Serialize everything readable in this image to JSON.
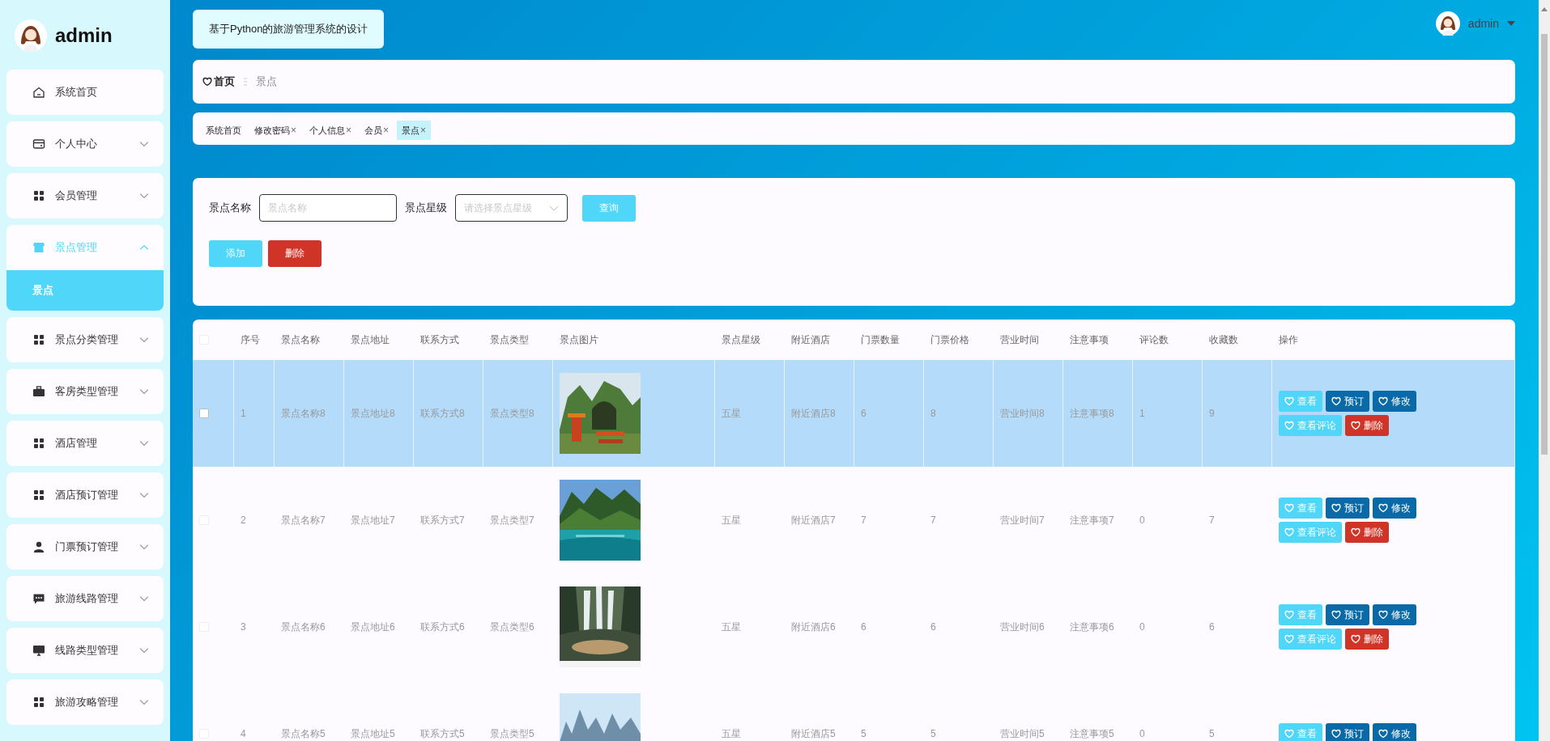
{
  "sidebar": {
    "brand": "admin",
    "items": [
      {
        "label": "系统首页",
        "kind": "link",
        "selected": false
      },
      {
        "label": "个人中心",
        "kind": "menu",
        "selected": false,
        "expanded": false
      },
      {
        "label": "会员管理",
        "kind": "menu",
        "selected": false,
        "expanded": false
      },
      {
        "label": "景点管理",
        "kind": "menu",
        "selected": true,
        "expanded": true,
        "children": [
          {
            "label": "景点",
            "selected": true
          }
        ]
      },
      {
        "label": "景点分类管理",
        "kind": "menu",
        "selected": false,
        "expanded": false
      },
      {
        "label": "客房类型管理",
        "kind": "menu",
        "selected": false,
        "expanded": false
      },
      {
        "label": "酒店管理",
        "kind": "menu",
        "selected": false,
        "expanded": false
      },
      {
        "label": "酒店预订管理",
        "kind": "menu",
        "selected": false,
        "expanded": false
      },
      {
        "label": "门票预订管理",
        "kind": "menu",
        "selected": false,
        "expanded": false
      },
      {
        "label": "旅游线路管理",
        "kind": "menu",
        "selected": false,
        "expanded": false
      },
      {
        "label": "线路类型管理",
        "kind": "menu",
        "selected": false,
        "expanded": false
      },
      {
        "label": "旅游攻略管理",
        "kind": "menu",
        "selected": false,
        "expanded": false
      }
    ]
  },
  "header": {
    "title": "基于Python的旅游管理系统的设计",
    "user": "admin"
  },
  "breadcrumb": [
    {
      "label": "首页",
      "kind": "home"
    },
    {
      "label": "景点",
      "kind": "current"
    }
  ],
  "tags": [
    {
      "label": "系统首页",
      "selected": false
    },
    {
      "label": "修改密码",
      "close": "×",
      "selected": false
    },
    {
      "label": "个人信息",
      "close": "×",
      "selected": false
    },
    {
      "label": "会员",
      "close": "×",
      "selected": false
    },
    {
      "label": "景点",
      "close": "×",
      "selected": true
    }
  ],
  "search": {
    "fields": [
      {
        "label": "景点名称",
        "placeholder": "景点名称",
        "kind": "input"
      },
      {
        "label": "景点星级",
        "placeholder": "请选择景点星级",
        "kind": "select"
      }
    ],
    "query_button": "查询",
    "buttons": [
      {
        "label": "添加",
        "kind": "info"
      },
      {
        "label": "删除",
        "kind": "danger"
      }
    ]
  },
  "table": {
    "select_all": {
      "checked": false
    },
    "columns": [
      {
        "label": "序号",
        "kind": "text"
      },
      {
        "label": "景点名称",
        "kind": "text"
      },
      {
        "label": "景点地址",
        "kind": "text"
      },
      {
        "label": "联系方式",
        "kind": "text"
      },
      {
        "label": "景点类型",
        "kind": "text"
      },
      {
        "label": "景点图片",
        "kind": "picture"
      },
      {
        "label": "景点星级",
        "kind": "text"
      },
      {
        "label": "附近酒店",
        "kind": "text"
      },
      {
        "label": "门票数量",
        "kind": "text"
      },
      {
        "label": "门票价格",
        "kind": "text"
      },
      {
        "label": "营业时间",
        "kind": "text"
      },
      {
        "label": "注意事项",
        "kind": "text"
      },
      {
        "label": "评论数",
        "kind": "text"
      },
      {
        "label": "收藏数",
        "kind": "text"
      },
      {
        "label": "操作",
        "kind": "actions"
      }
    ],
    "rows": [
      {
        "selected": true,
        "checked": false,
        "cells": [
          "1",
          "景点名称8",
          "景点地址8",
          "联系方式8",
          "景点类型8",
          {
            "kind": "picture"
          },
          "五星",
          "附近酒店8",
          "6",
          "8",
          "营业时间8",
          "注意事项8",
          "1",
          "9"
        ],
        "actions": [
          {
            "label": "查看",
            "kind": "info"
          },
          {
            "label": "预订",
            "kind": "primary"
          },
          {
            "label": "修改",
            "kind": "primary"
          },
          {
            "label": "查看评论",
            "kind": "info"
          },
          {
            "label": "删除",
            "kind": "danger"
          }
        ]
      },
      {
        "selected": false,
        "checked": false,
        "cells": [
          "2",
          "景点名称7",
          "景点地址7",
          "联系方式7",
          "景点类型7",
          {
            "kind": "picture"
          },
          "五星",
          "附近酒店7",
          "7",
          "7",
          "营业时间7",
          "注意事项7",
          "0",
          "7"
        ],
        "actions": [
          {
            "label": "查看",
            "kind": "info"
          },
          {
            "label": "预订",
            "kind": "primary"
          },
          {
            "label": "修改",
            "kind": "primary"
          },
          {
            "label": "查看评论",
            "kind": "info"
          },
          {
            "label": "删除",
            "kind": "danger"
          }
        ]
      },
      {
        "selected": false,
        "checked": false,
        "cells": [
          "3",
          "景点名称6",
          "景点地址6",
          "联系方式6",
          "景点类型6",
          {
            "kind": "picture"
          },
          "五星",
          "附近酒店6",
          "6",
          "6",
          "营业时间6",
          "注意事项6",
          "0",
          "6"
        ],
        "actions": [
          {
            "label": "查看",
            "kind": "info"
          },
          {
            "label": "预订",
            "kind": "primary"
          },
          {
            "label": "修改",
            "kind": "primary"
          },
          {
            "label": "查看评论",
            "kind": "info"
          },
          {
            "label": "删除",
            "kind": "danger"
          }
        ]
      },
      {
        "selected": false,
        "checked": false,
        "cells": [
          "4",
          "景点名称5",
          "景点地址5",
          "联系方式5",
          "景点类型5",
          {
            "kind": "picture"
          },
          "五星",
          "附近酒店5",
          "5",
          "5",
          "营业时间5",
          "注意事项5",
          "0",
          "5"
        ],
        "actions": [
          {
            "label": "查看",
            "kind": "info"
          },
          {
            "label": "预订",
            "kind": "primary"
          },
          {
            "label": "修改",
            "kind": "primary"
          }
        ]
      }
    ]
  }
}
